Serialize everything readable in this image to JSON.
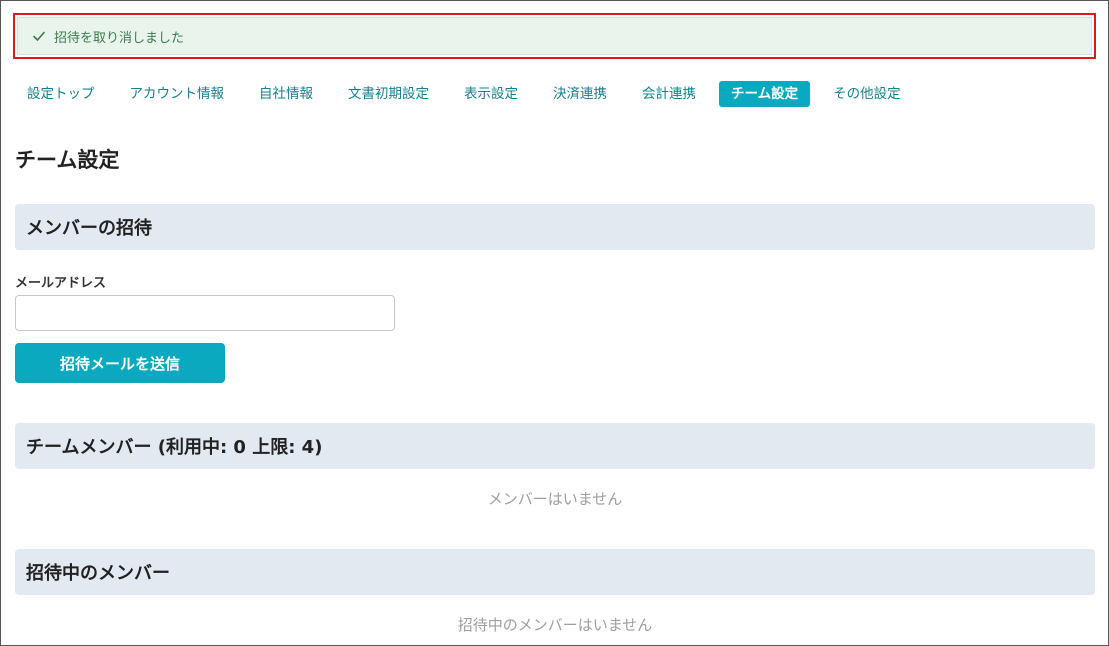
{
  "flash": {
    "message": "招待を取り消しました",
    "icon": "check-icon"
  },
  "tabs": [
    {
      "label": "設定トップ",
      "active": false
    },
    {
      "label": "アカウント情報",
      "active": false
    },
    {
      "label": "自社情報",
      "active": false
    },
    {
      "label": "文書初期設定",
      "active": false
    },
    {
      "label": "表示設定",
      "active": false
    },
    {
      "label": "決済連携",
      "active": false
    },
    {
      "label": "会計連携",
      "active": false
    },
    {
      "label": "チーム設定",
      "active": true
    },
    {
      "label": "その他設定",
      "active": false
    }
  ],
  "page": {
    "title": "チーム設定"
  },
  "invite": {
    "header": "メンバーの招待",
    "email_label": "メールアドレス",
    "email_value": "",
    "send_label": "招待メールを送信"
  },
  "members": {
    "header": "チームメンバー (利用中: 0 上限: 4)",
    "empty_text": "メンバーはいません"
  },
  "pending": {
    "header": "招待中のメンバー",
    "empty_text": "招待中のメンバーはいません"
  },
  "colors": {
    "accent": "#0ba9bf",
    "tab_text": "#15808f",
    "flash_bg": "#e9f5ec",
    "flash_text": "#3d7a4e",
    "flash_outline": "#e0161e",
    "section_bg": "#e3e9f1"
  }
}
